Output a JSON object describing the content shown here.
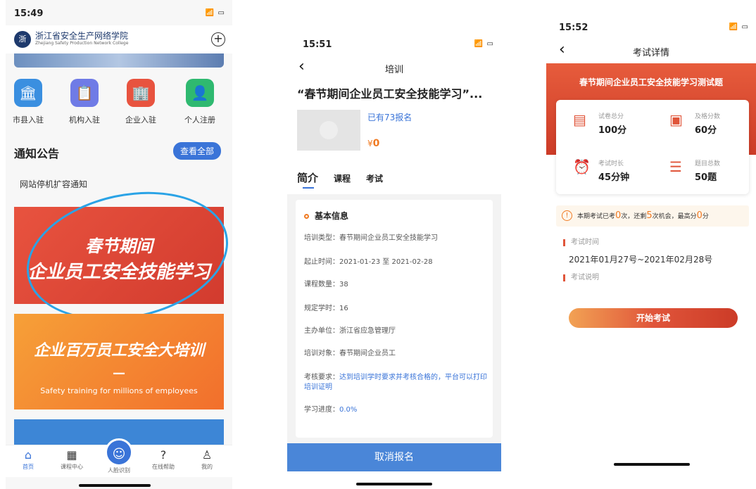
{
  "screen1": {
    "status_time": "15:49",
    "status_icons": "📶 ▭",
    "logo_name": "浙江省安全生产网络学院",
    "logo_en": "Zhejiang Safety Production Network College",
    "add_button": "⊕",
    "entries": [
      {
        "label": "市县入驻",
        "color": "#3a8fe0",
        "icon": "🏛"
      },
      {
        "label": "机构入驻",
        "color": "#6f7be6",
        "icon": "📋"
      },
      {
        "label": "企业入驻",
        "color": "#e8533f",
        "icon": "🏢"
      },
      {
        "label": "个人注册",
        "color": "#2fb970",
        "icon": "👤"
      }
    ],
    "notice_title": "通知公告",
    "view_all": "查看全部",
    "notice_item": "网站停机扩容通知",
    "banner1_line1": "春节期间",
    "banner1_line2": "企业员工安全技能学习",
    "banner2_title": "企业百万员工安全大培训",
    "banner2_sub": "Safety training for millions of employees",
    "tabs": [
      {
        "label": "首页",
        "icon": "⌂"
      },
      {
        "label": "课程中心",
        "icon": "▦"
      },
      {
        "label": "人脸识别",
        "icon": "☺"
      },
      {
        "label": "在线帮助",
        "icon": "?"
      },
      {
        "label": "我的",
        "icon": "♙"
      }
    ]
  },
  "screen2": {
    "status_time": "15:51",
    "nav_title": "培训",
    "course_title": "“春节期间企业员工安全技能学习”...",
    "enroll_count": "已有73报名",
    "price": "0",
    "price_symbol": "¥",
    "tabs": [
      "简介",
      "课程",
      "考试"
    ],
    "section_title": "基本信息",
    "rows": [
      {
        "label": "培训类型：",
        "value": "春节期间企业员工安全技能学习"
      },
      {
        "label": "起止时间：",
        "value": "2021-01-23 至 2021-02-28"
      },
      {
        "label": "课程数量：",
        "value": "38"
      },
      {
        "label": "规定学时：",
        "value": "16"
      },
      {
        "label": "主办单位：",
        "value": "浙江省应急管理厅"
      },
      {
        "label": "培训对象：",
        "value": "春节期间企业员工"
      },
      {
        "label": "考核要求：",
        "value": "达到培训学时要求并考核合格的，平台可以打印培训证明"
      },
      {
        "label": "学习进度：",
        "value": "0.0%"
      }
    ],
    "cancel_button": "取消报名"
  },
  "screen3": {
    "status_time": "15:52",
    "nav_title": "考试详情",
    "exam_name": "春节期间企业员工安全技能学习测试题",
    "stats": [
      {
        "label": "试卷总分",
        "value": "100分",
        "icon": "▤"
      },
      {
        "label": "及格分数",
        "value": "60分",
        "icon": "▣"
      },
      {
        "label": "考试时长",
        "value": "45分钟",
        "icon": "⏰"
      },
      {
        "label": "题目总数",
        "value": "50题",
        "icon": "☰"
      }
    ],
    "attempt_prefix": "本期考试已考",
    "attempt_taken": "0",
    "attempt_mid": "次，还剩",
    "attempt_left": "5",
    "attempt_mid2": "次机会，最高分",
    "attempt_best": "0",
    "attempt_suffix": "分",
    "exam_time_label": "考试时间",
    "exam_time_value": "2021年01月27号~2021年02月28号",
    "exam_desc_label": "考试说明",
    "start_button": "开始考试"
  }
}
